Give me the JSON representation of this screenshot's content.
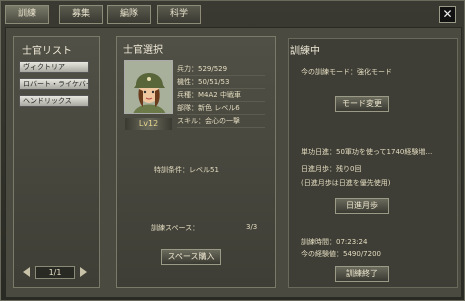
{
  "tabs": [
    {
      "label": "訓練",
      "active": true
    },
    {
      "label": "募集",
      "active": false
    },
    {
      "label": "編隊",
      "active": false
    },
    {
      "label": "科学",
      "active": false
    }
  ],
  "close_label": "✕",
  "officer_list": {
    "title": "士官リスト",
    "items": [
      "ヴィクトリア",
      "ロバート・ライケバード…",
      "ヘンドリックス"
    ],
    "page": "1/1"
  },
  "officer_select": {
    "title": "士官選択",
    "level": "Lv12",
    "stats": [
      "兵力：529/529",
      "機性：50/51/53",
      "兵種：M4A2 中戦車",
      "部隊：新色 レベル6",
      "スキル：会心の一撃"
    ],
    "condition": "特訓条件：レベル51",
    "space_label": "訓練スペース：",
    "space_value": "3/3",
    "buy_space_button": "スペース購入"
  },
  "training": {
    "title": "訓練中",
    "mode_label": "今の訓練モード：強化モード",
    "mode_change_button": "モード変更",
    "exp_rate": "単功日進：50軍功を使って1740経験増…",
    "daily_remaining": "日進月歩：残り0回",
    "daily_note": "(日進月歩は日進を優先使用)",
    "daily_button": "日進月歩",
    "train_time": "訓練時間：07:23:24",
    "current_exp": "今の経験値：5490/7200",
    "end_button": "訓練終了"
  }
}
